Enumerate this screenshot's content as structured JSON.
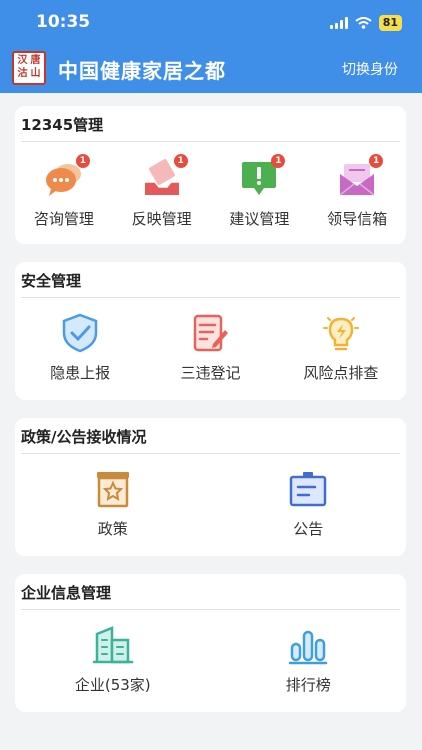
{
  "status": {
    "time": "10:35",
    "battery": "81"
  },
  "header": {
    "logo_chars": [
      "汉",
      "唐",
      "沽",
      "山"
    ],
    "title": "中国健康家居之都",
    "switch_role": "切换身份"
  },
  "sections": [
    {
      "title": "12345管理",
      "items": [
        {
          "label": "咨询管理",
          "badge": "1",
          "icon": "chat-bubbles-icon"
        },
        {
          "label": "反映管理",
          "badge": "1",
          "icon": "tray-report-icon"
        },
        {
          "label": "建议管理",
          "badge": "1",
          "icon": "exclamation-message-icon"
        },
        {
          "label": "领导信箱",
          "badge": "1",
          "icon": "mailbox-icon"
        }
      ]
    },
    {
      "title": "安全管理",
      "items": [
        {
          "label": "隐患上报",
          "icon": "shield-check-icon"
        },
        {
          "label": "三违登记",
          "icon": "document-edit-icon"
        },
        {
          "label": "风险点排查",
          "icon": "lightbulb-bolt-icon"
        }
      ]
    },
    {
      "title": "政策/公告接收情况",
      "items": [
        {
          "label": "政策",
          "icon": "policy-star-icon"
        },
        {
          "label": "公告",
          "icon": "notice-board-icon"
        }
      ]
    },
    {
      "title": "企业信息管理",
      "items": [
        {
          "label": "企业(53家)",
          "icon": "buildings-icon"
        },
        {
          "label": "排行榜",
          "icon": "bar-chart-icon"
        }
      ]
    }
  ],
  "colors": {
    "header": "#3f8ee8",
    "badge": "#e74c3c",
    "background": "#f2f3f5"
  }
}
